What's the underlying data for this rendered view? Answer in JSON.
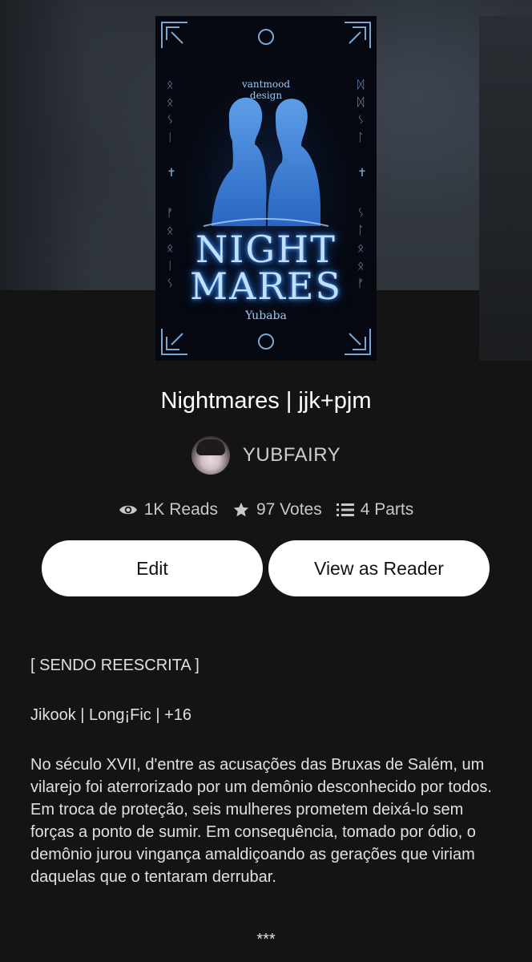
{
  "cover": {
    "design_credit_line1": "vantmood",
    "design_credit_line2": "design",
    "title_line1": "NIGHT",
    "title_line2": "MARES",
    "author": "Yubaba"
  },
  "story": {
    "title": "Nightmares  | jjk+pjm",
    "author": "YUBFAIRY"
  },
  "stats": {
    "reads": "1K Reads",
    "votes": "97 Votes",
    "parts": "4 Parts",
    "reads_icon": "eye-icon",
    "votes_icon": "star-icon",
    "parts_icon": "list-icon"
  },
  "actions": {
    "edit_label": "Edit",
    "view_label": "View as Reader"
  },
  "description": {
    "status": "[  SENDO REESCRITA ]",
    "tags": "Jikook | Long¡Fic | +16",
    "synopsis": "No século XVII, d'entre as acusações das Bruxas de Salém, um vilarejo foi aterrorizado por um demônio desconhecido por todos. Em troca de proteção, seis mulheres prometem deixá-lo sem forças a ponto de sumir. Em consequência, tomado por ódio, o demônio jurou vingança amaldiçoando as gerações que viriam daquelas que o tentaram derrubar.",
    "separator": "***"
  },
  "colors": {
    "background": "#141414",
    "button_bg": "#ffffff",
    "button_text": "#121212",
    "cover_glow": "#4a9cff"
  }
}
